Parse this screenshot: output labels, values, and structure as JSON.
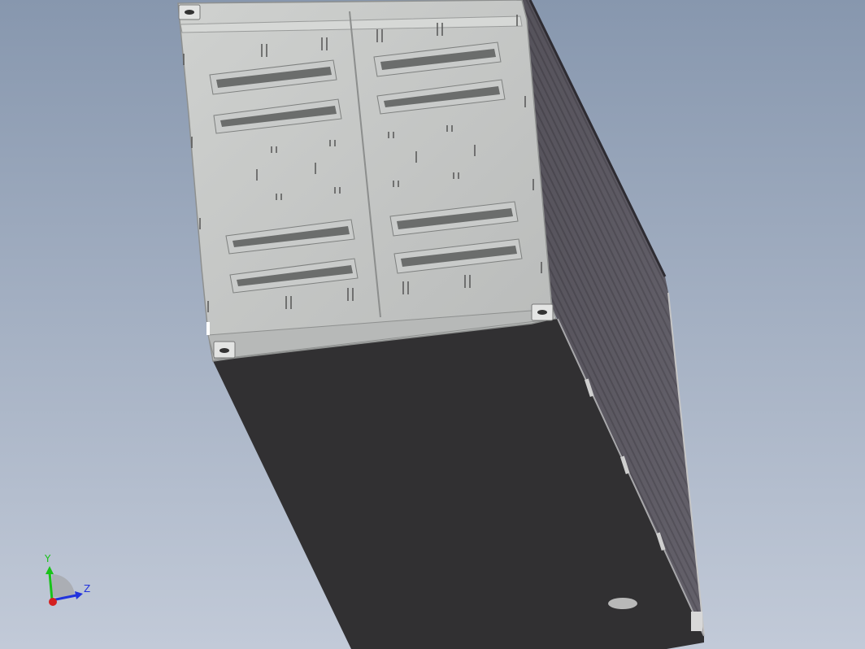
{
  "viewport": {
    "background_top": "#8797ae",
    "background_bottom": "#c2cad8"
  },
  "model": {
    "door_face_color": "#c4c6c4",
    "door_shadow_color": "#8e908f",
    "floor_color": "#313032",
    "side_wall_color": "#5e5b64",
    "corrugation_color": "#46434b"
  },
  "triad": {
    "y_label": "Y",
    "z_label": "Z",
    "y_color": "#19c219",
    "z_color": "#2233dd",
    "origin_color": "#d42020"
  }
}
